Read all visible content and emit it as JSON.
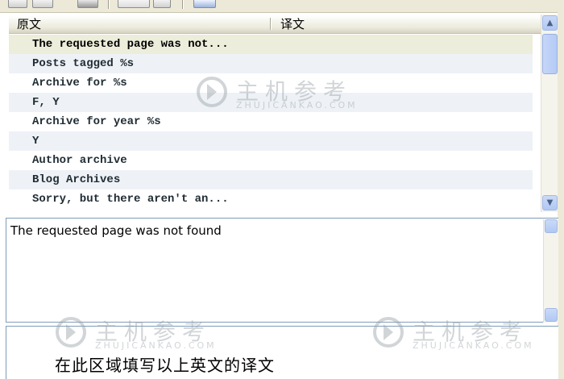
{
  "list": {
    "headers": {
      "source": "原文",
      "translation": "译文"
    },
    "rows": [
      "The requested page was not...",
      "Posts tagged %s",
      "Archive for %s",
      "F, Y",
      "Archive for year %s",
      "Y",
      "Author archive",
      "Blog Archives",
      "Sorry, but there aren't an..."
    ],
    "selected_index": 0
  },
  "source_pane": {
    "text": "The requested page was not found"
  },
  "translation_pane": {
    "hint": "在此区域填写以上英文的译文"
  },
  "watermark": {
    "cn": "主机参考",
    "en": "ZHUJICANKAO.COM"
  },
  "icons": {
    "up": "▲",
    "down": "▼"
  },
  "colors": {
    "selected_row": "#ecedda",
    "alt_row": "#eef2f7",
    "border": "#7f9db9"
  }
}
